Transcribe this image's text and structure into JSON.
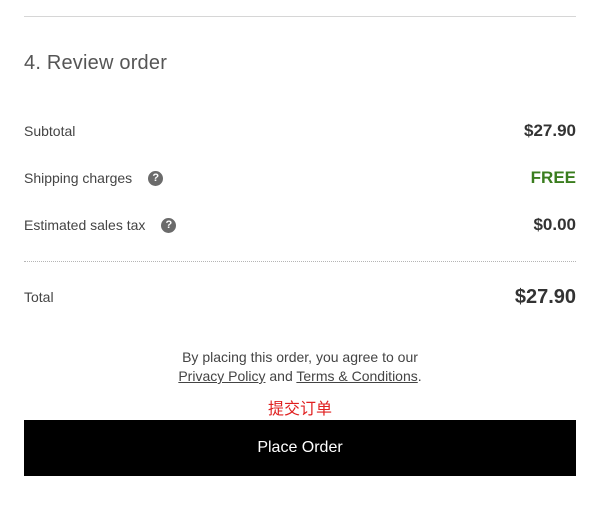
{
  "section": {
    "title": "4. Review order"
  },
  "summary": {
    "subtotal": {
      "label": "Subtotal",
      "value": "$27.90"
    },
    "shipping": {
      "label": "Shipping charges",
      "value": "FREE",
      "help_icon": "question-mark-circle"
    },
    "tax": {
      "label": "Estimated sales tax",
      "value": "$0.00",
      "help_icon": "question-mark-circle"
    },
    "total": {
      "label": "Total",
      "value": "$27.90"
    }
  },
  "legal": {
    "prefix": "By placing this order, you agree to our",
    "privacy_link": "Privacy Policy",
    "and_text": "and",
    "terms_link": "Terms & Conditions",
    "suffix": "."
  },
  "annotation": {
    "text": "提交订单",
    "color": "#e02020"
  },
  "place_order": {
    "label": "Place Order"
  },
  "colors": {
    "free": "#3a7d1e",
    "button_bg": "#000000",
    "button_text": "#ffffff"
  }
}
